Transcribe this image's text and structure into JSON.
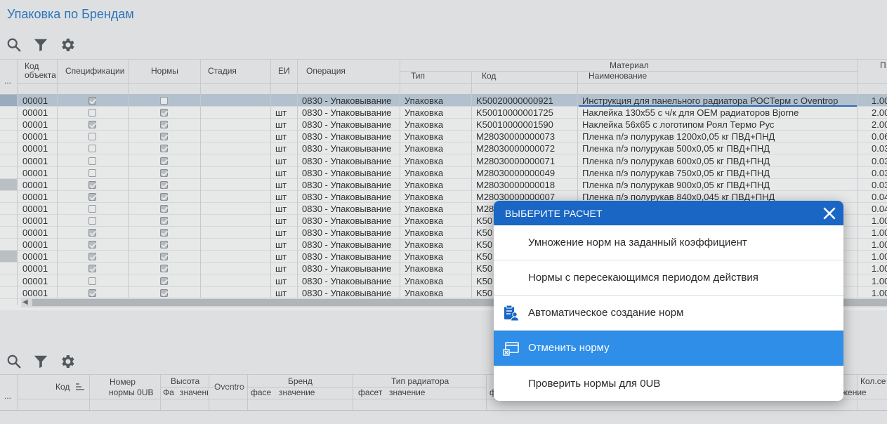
{
  "page": {
    "title": "Упаковка по Брендам"
  },
  "grid": {
    "headers": {
      "more": "...",
      "code_obj": "Код объекта",
      "spec": "Спецификации",
      "norms": "Нормы",
      "stage": "Стадия",
      "unit": "ЕИ",
      "operation": "Операция",
      "material": "Материал",
      "type": "Тип",
      "code": "Код",
      "name": "Наименование",
      "p": "П"
    },
    "rows": [
      {
        "code_obj": "00001",
        "spec": true,
        "norm": false,
        "unit": "",
        "op": "0830 - Упаковывание",
        "type": "Упаковка",
        "code": "K50020000000921",
        "name": "Инструкция для панельного радиатора РОСТерм с Oventrop",
        "p": "1.00"
      },
      {
        "code_obj": "00001",
        "spec": false,
        "norm": true,
        "unit": "шт",
        "op": "0830 - Упаковывание",
        "type": "Упаковка",
        "code": "K50010000001725",
        "name": " Наклейка 130х55 с ч/к для ОЕМ радиаторов Bjorne",
        "p": "2.00"
      },
      {
        "code_obj": "00001",
        "spec": true,
        "norm": true,
        "unit": "шт",
        "op": "0830 - Упаковывание",
        "type": "Упаковка",
        "code": "K50010000001590",
        "name": "Наклейка 56х65 с логотипом Роял Термо Рус",
        "p": "2.00"
      },
      {
        "code_obj": "00001",
        "spec": false,
        "norm": true,
        "unit": "шт",
        "op": "0830 - Упаковывание",
        "type": "Упаковка",
        "code": "M28030000000073",
        "name": "Пленка п/э полурукав 1200х0,05 кг ПВД+ПНД",
        "p": "0.06"
      },
      {
        "code_obj": "00001",
        "spec": false,
        "norm": true,
        "unit": "шт",
        "op": "0830 - Упаковывание",
        "type": "Упаковка",
        "code": "M28030000000072",
        "name": "Пленка п/э полурукав 500х0,05 кг ПВД+ПНД",
        "p": "0.03"
      },
      {
        "code_obj": "00001",
        "spec": false,
        "norm": true,
        "unit": "шт",
        "op": "0830 - Упаковывание",
        "type": "Упаковка",
        "code": "M28030000000071",
        "name": "Пленка п/э полурукав 600х0,05 кг ПВД+ПНД",
        "p": "0.03"
      },
      {
        "code_obj": "00001",
        "spec": false,
        "norm": true,
        "unit": "шт",
        "op": "0830 - Упаковывание",
        "type": "Упаковка",
        "code": "M28030000000049",
        "name": " Пленка п/э полурукав 750х0,05 кг ПВД+ПНД",
        "p": "0.03"
      },
      {
        "code_obj": "00001",
        "spec": true,
        "norm": true,
        "unit": "шт",
        "op": "0830 - Упаковывание",
        "type": "Упаковка",
        "code": "M28030000000018",
        "name": " Пленка п/э полурукав 900х0,05 кг ПВД+ПНД",
        "p": "0.03"
      },
      {
        "code_obj": "00001",
        "spec": true,
        "norm": true,
        "unit": "шт",
        "op": "0830 - Упаковывание",
        "type": "Упаковка",
        "code": "M28030000000007",
        "name": " Пленка п/э полурукав 840х0,045 кг ПВД+ПНД",
        "p": "0.04"
      },
      {
        "code_obj": "00001",
        "spec": false,
        "norm": true,
        "unit": "шт",
        "op": "0830 - Упаковывание",
        "type": "Упаковка",
        "code": "M28",
        "name": "",
        "p": "0.04"
      },
      {
        "code_obj": "00001",
        "spec": false,
        "norm": true,
        "unit": "шт",
        "op": "0830 - Упаковывание",
        "type": "Упаковка",
        "code": "K50",
        "name": "",
        "p": "1.00"
      },
      {
        "code_obj": "00001",
        "spec": true,
        "norm": true,
        "unit": "шт",
        "op": "0830 - Упаковывание",
        "type": "Упаковка",
        "code": "K50",
        "name": "",
        "p": "1.00"
      },
      {
        "code_obj": "00001",
        "spec": true,
        "norm": true,
        "unit": "шт",
        "op": "0830 - Упаковывание",
        "type": "Упаковка",
        "code": "K50",
        "name": "",
        "p": "1.00"
      },
      {
        "code_obj": "00001",
        "spec": true,
        "norm": true,
        "unit": "шт",
        "op": "0830 - Упаковывание",
        "type": "Упаковка",
        "code": "K50",
        "name": "",
        "p": "1.00"
      },
      {
        "code_obj": "00001",
        "spec": true,
        "norm": true,
        "unit": "шт",
        "op": "0830 - Упаковывание",
        "type": "Упаковка",
        "code": "K50",
        "name": "",
        "p": "1.00"
      },
      {
        "code_obj": "00001",
        "spec": false,
        "norm": true,
        "unit": "шт",
        "op": "0830 - Упаковывание",
        "type": "Упаковка",
        "code": "K50",
        "name": "",
        "p": "1.00"
      },
      {
        "code_obj": "00001",
        "spec": true,
        "norm": true,
        "unit": "шт",
        "op": "0830 - Упаковывание",
        "type": "Упаковка",
        "code": "K50",
        "name": "",
        "p": "1.00"
      }
    ]
  },
  "grid2": {
    "headers": {
      "more": "...",
      "code": "Код",
      "nomer": "Номер",
      "norm_0ub": "нормы 0UB",
      "height": "Высота",
      "fa": "Фа",
      "value": "значение",
      "oventro": "Oventro",
      "brand": "Бренд",
      "facet": "фасе",
      "brand_value": "значение",
      "rad_type": "Тип радиатора",
      "facet2": "фасет",
      "rad_value": "значение",
      "f": "ф",
      "qty": "Кол.се",
      "zhenie": "жение"
    }
  },
  "dialog": {
    "title": "ВЫБЕРИТЕ РАСЧЕТ",
    "items": [
      {
        "label": "Умножение норм на заданный коэффициент",
        "icon": ""
      },
      {
        "label": "Нормы с пересекающимся периодом действия",
        "icon": ""
      },
      {
        "label": "Автоматическое создание норм",
        "icon": "auto-norm-icon"
      },
      {
        "label": "Отменить норму",
        "icon": "cancel-norm-icon"
      },
      {
        "label": "Проверить нормы для 0UB",
        "icon": ""
      }
    ],
    "active_index": 3
  },
  "colors": {
    "accent": "#1966c4",
    "active_item": "#2e8ee8",
    "title": "#1a73c8"
  }
}
